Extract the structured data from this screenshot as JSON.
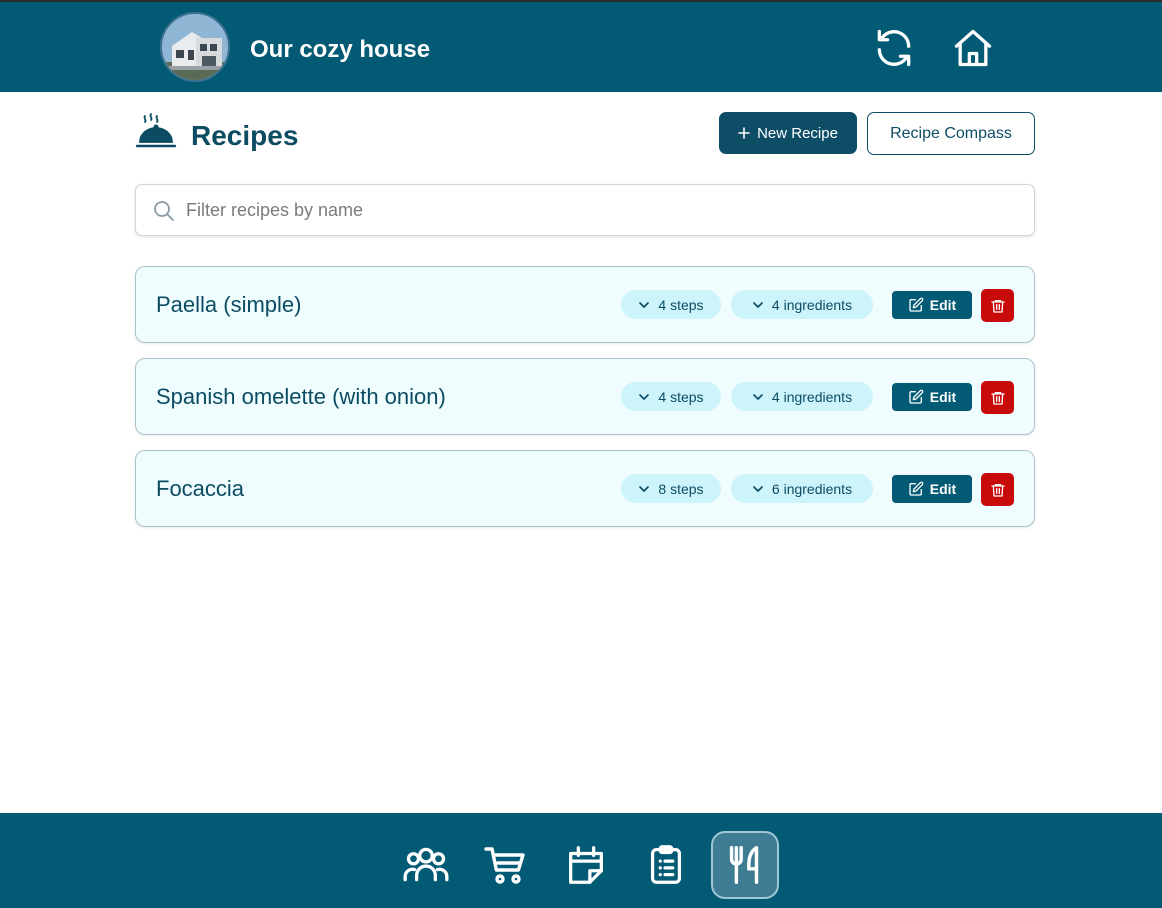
{
  "header": {
    "house_name": "Our cozy house",
    "avatar_alt": "house-photo",
    "actions": [
      {
        "icon": "sync-icon"
      },
      {
        "icon": "home-icon"
      }
    ]
  },
  "page": {
    "title": "Recipes",
    "title_icon": "cloche-icon",
    "new_recipe_label": "New Recipe",
    "compass_label": "Recipe Compass"
  },
  "search": {
    "placeholder": "Filter recipes by name",
    "value": ""
  },
  "recipes": [
    {
      "name": "Paella (simple)",
      "steps": "4 steps",
      "ingredients": "4 ingredients",
      "edit_label": "Edit"
    },
    {
      "name": "Spanish omelette (with onion)",
      "steps": "4 steps",
      "ingredients": "4 ingredients",
      "edit_label": "Edit"
    },
    {
      "name": "Focaccia",
      "steps": "8 steps",
      "ingredients": "6 ingredients",
      "edit_label": "Edit"
    }
  ],
  "bottom_nav": [
    {
      "icon": "members-icon",
      "active": false
    },
    {
      "icon": "shopping-cart-icon",
      "active": false
    },
    {
      "icon": "calendar-icon",
      "active": false
    },
    {
      "icon": "clipboard-list-icon",
      "active": false
    },
    {
      "icon": "fork-knife-icon",
      "active": true
    }
  ],
  "colors": {
    "brand": "#025a75",
    "card_bg": "#effdff",
    "pill_bg": "#cdf3fb",
    "danger": "#c80a0a"
  }
}
